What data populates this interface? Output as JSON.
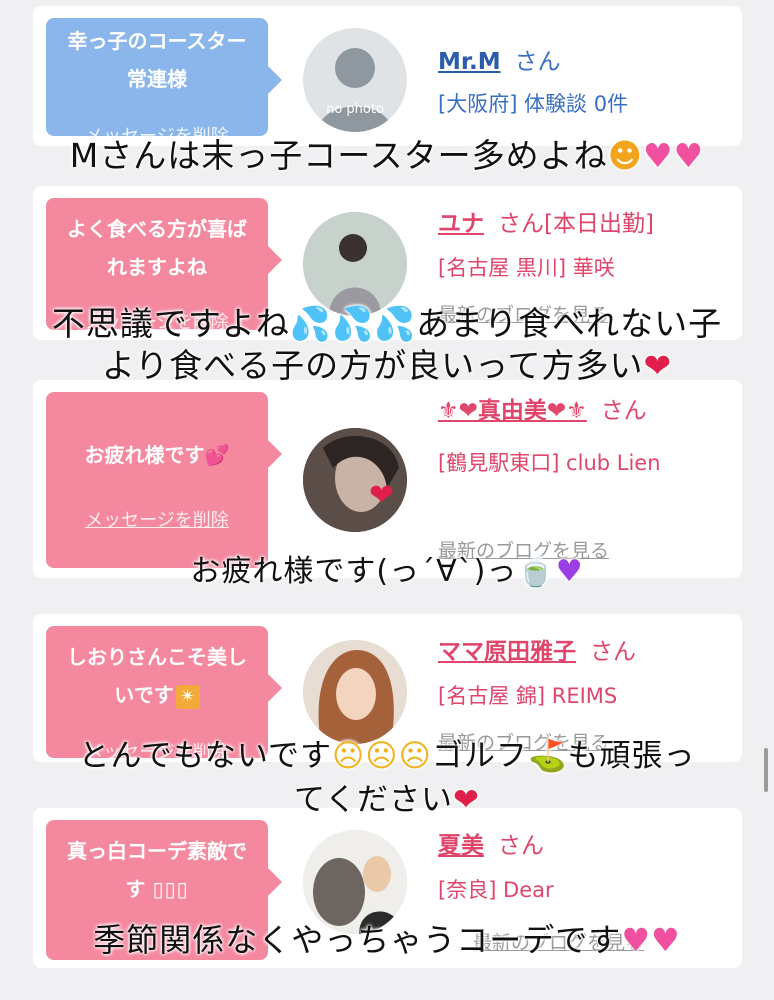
{
  "cards": [
    {
      "message": "幸っ子のコースター常連様",
      "delete_label": "メッセージを削除",
      "name": "Mr.M",
      "honorific": "さん",
      "line2": "[大阪府] 体験談 0件",
      "avatar_text": "no photo",
      "blog_label": ""
    },
    {
      "message": "よく食べる方が喜ばれますよね",
      "delete_label": "メッセージを削除",
      "name": "ユナ",
      "honorific": "さん[本日出勤]",
      "line2": "[名古屋 黒川] 華咲",
      "blog_label": "最新のブログを見る"
    },
    {
      "message": "お疲れ様です",
      "delete_label": "メッセージを削除",
      "name": "⚜❤真由美❤⚜",
      "honorific": "さん",
      "line2": "[鶴見駅東口] club Lien",
      "blog_label": "最新のブログを見る"
    },
    {
      "message": "しおりさんこそ美しいです",
      "delete_label": "メッセージを削除",
      "name": "ママ原田雅子",
      "honorific": "さん",
      "line2": "[名古屋 錦] REIMS",
      "blog_label": "最新のブログを見る"
    },
    {
      "message": "真っ白コーデ素敵です",
      "delete_label": "メッセージを削除",
      "name": "夏美",
      "honorific": "さん",
      "line2": "[奈良] Dear",
      "blog_label": "最新のブログを見る"
    }
  ],
  "captions": [
    "Mさんは末っ子コースター多めよね",
    "不思議ですよね",
    "あまり食べれない子",
    "より食べる子の方が良いって方多い",
    "お疲れ様です(っ´∀`)っ",
    "とんでもないです",
    "ゴルフ",
    "も頑張っ",
    "てください",
    "季節関係なくやっちゃうコーデです"
  ],
  "colors": {
    "blue_bubble": "#8ab6ec",
    "pink_bubble": "#f4889f",
    "name_blue": "#2a5caa",
    "name_pink": "#e0456b",
    "info_blue": "#3a6fc0",
    "info_pink": "#e0456b"
  }
}
